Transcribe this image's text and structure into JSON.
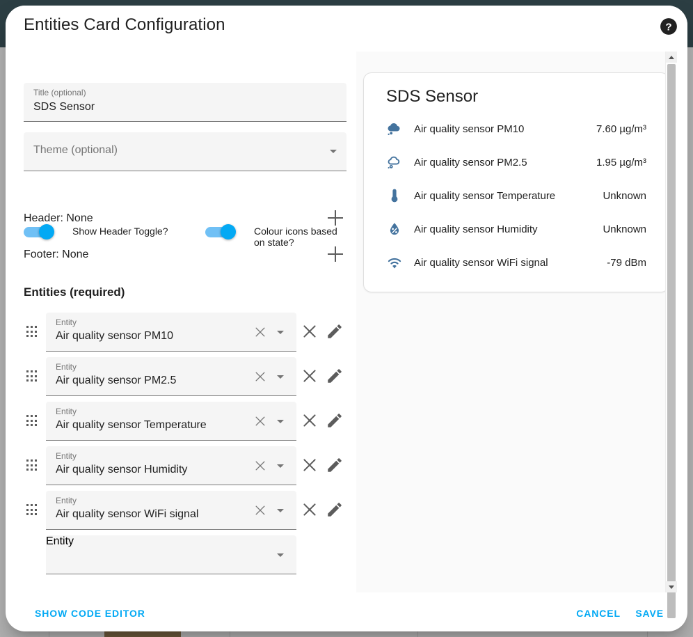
{
  "dialog": {
    "title": "Entities Card Configuration",
    "help_icon": "help-circle-icon"
  },
  "form": {
    "title_field": {
      "label": "Title (optional)",
      "value": "SDS Sensor"
    },
    "theme_field": {
      "label": "Theme (optional)",
      "placeholder": "Theme (optional)",
      "value": ""
    },
    "toggles": [
      {
        "label": "Show Header Toggle?",
        "state": "on"
      },
      {
        "label": "Colour icons based on state?",
        "state": "on"
      }
    ],
    "header_row": {
      "label": "Header: None",
      "add_icon": "plus-icon"
    },
    "footer_row": {
      "label": "Footer: None",
      "add_icon": "plus-icon"
    },
    "entities_heading": "Entities (required)",
    "entity_field_label": "Entity",
    "entity_field_placeholder": "Entity",
    "entity_rows": [
      {
        "label": "Entity",
        "value": "Air quality sensor PM10"
      },
      {
        "label": "Entity",
        "value": "Air quality sensor PM2.5"
      },
      {
        "label": "Entity",
        "value": "Air quality sensor Temperature"
      },
      {
        "label": "Entity",
        "value": "Air quality sensor Humidity"
      },
      {
        "label": "Entity",
        "value": "Air quality sensor WiFi signal"
      }
    ],
    "empty_entity_placeholder": "Entity"
  },
  "preview": {
    "card_title": "SDS Sensor",
    "rows": [
      {
        "icon": "cloud-pm10-icon",
        "name": "Air quality sensor PM10",
        "state": "7.60 µg/m³"
      },
      {
        "icon": "cloud-pm25-icon",
        "name": "Air quality sensor PM2.5",
        "state": "1.95 µg/m³"
      },
      {
        "icon": "thermometer-icon",
        "name": "Air quality sensor Temperature",
        "state": "Unknown"
      },
      {
        "icon": "water-percent-icon",
        "name": "Air quality sensor Humidity",
        "state": "Unknown"
      },
      {
        "icon": "wifi-icon",
        "name": "Air quality sensor WiFi signal",
        "state": "-79 dBm"
      }
    ]
  },
  "actions": {
    "show_code_editor": "SHOW CODE EDITOR",
    "cancel": "CANCEL",
    "save": "SAVE"
  },
  "colors": {
    "accent": "#03a9f4",
    "state_icon": "#44739e",
    "backdrop": "#2c3e43",
    "field_bg": "#f5f5f5"
  }
}
